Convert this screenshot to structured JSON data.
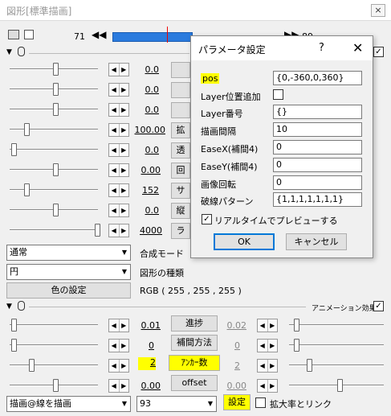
{
  "window": {
    "title": "図形[標準描画]",
    "close": "×"
  },
  "timeline": {
    "frame": "71",
    "right_frame": "89"
  },
  "sliders": [
    {
      "value": "0.0",
      "button": ""
    },
    {
      "value": "0.0",
      "button": ""
    },
    {
      "value": "0.0",
      "button": ""
    },
    {
      "value": "100.00",
      "button": "拡"
    },
    {
      "value": "0.0",
      "button": "透"
    },
    {
      "value": "0.00",
      "button": "回"
    },
    {
      "value": "152",
      "button": "サ"
    },
    {
      "value": "0.0",
      "button": "縦"
    },
    {
      "value": "4000",
      "button": "ラ"
    }
  ],
  "blend": {
    "value": "通常",
    "label": "合成モード"
  },
  "shape": {
    "value": "円",
    "label": "図形の種類"
  },
  "color": {
    "button": "色の設定",
    "rgb": "RGB ( 255 , 255 , 255 )"
  },
  "anim_header": {
    "label": "アニメーション効果",
    "checked": "✓"
  },
  "anim_rows": [
    {
      "value": "0.01",
      "button": "進捗",
      "right": "0.02"
    },
    {
      "value": "0",
      "button": "補間方法",
      "right": "0"
    },
    {
      "value": "2",
      "button": "ｱﾝｶｰ数",
      "right": "2"
    },
    {
      "value": "0.00",
      "button": "offset",
      "right": "0.00"
    }
  ],
  "bottom": {
    "effect": "描画@線を描画",
    "number": "93",
    "settings": "設定",
    "link_label": "拡大率とリンク"
  },
  "dialog": {
    "title": "パラメータ設定",
    "help": "?",
    "close": "✕",
    "rows": [
      {
        "label": "pos",
        "value": "{0,-360,0,360}"
      },
      {
        "label": "Layer位置追加",
        "value": ""
      },
      {
        "label": "Layer番号",
        "value": "{}"
      },
      {
        "label": "描画間隔",
        "value": "10"
      },
      {
        "label": "EaseX(補間4)",
        "value": "0"
      },
      {
        "label": "EaseY(補間4)",
        "value": "0"
      },
      {
        "label": "画像回転",
        "value": "0"
      },
      {
        "label": "破線パターン",
        "value": "{1,1,1,1,1,1,1}"
      }
    ],
    "realtime": "リアルタイムでプレビューする",
    "realtime_checked": "✓",
    "ok": "OK",
    "cancel": "キャンセル"
  }
}
